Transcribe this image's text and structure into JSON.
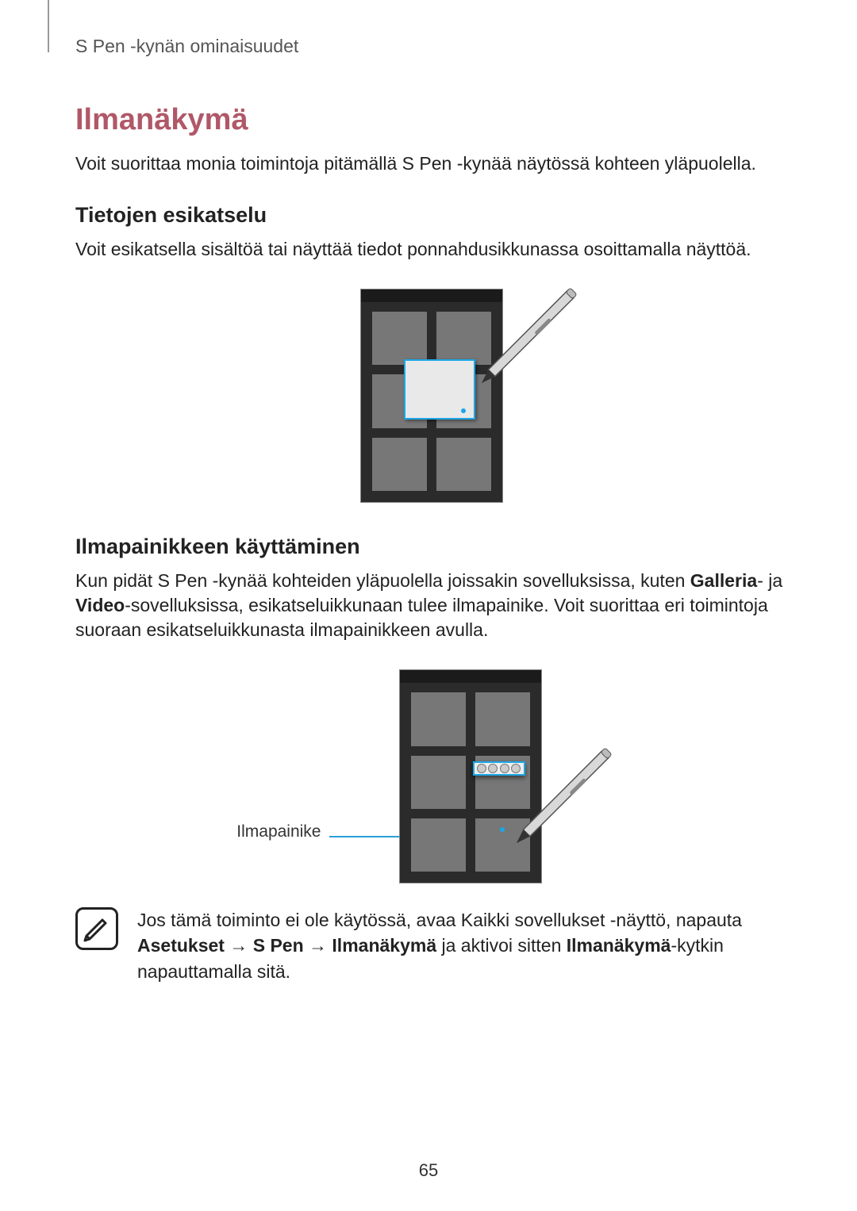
{
  "header": {
    "section": "S Pen -kynän ominaisuudet"
  },
  "title": "Ilmanäkymä",
  "intro": "Voit suorittaa monia toimintoja pitämällä S Pen -kynää näytössä kohteen yläpuolella.",
  "section1": {
    "heading": "Tietojen esikatselu",
    "body": "Voit esikatsella sisältöä tai näyttää tiedot ponnahdusikkunassa osoittamalla näyttöä."
  },
  "section2": {
    "heading": "Ilmapainikkeen käyttäminen",
    "body_pre": "Kun pidät S Pen -kynää kohteiden yläpuolella joissakin sovelluksissa, kuten ",
    "bold1": "Galleria",
    "body_mid1": "- ja ",
    "bold2": "Video",
    "body_post": "-sovelluksissa, esikatseluikkunaan tulee ilmapainike. Voit suorittaa eri toimintoja suoraan esikatseluikkunasta ilmapainikkeen avulla.",
    "figure_label": "Ilmapainike"
  },
  "note": {
    "pre": "Jos tämä toiminto ei ole käytössä, avaa Kaikki sovellukset -näyttö, napauta ",
    "b1": "Asetukset",
    "arrow": " → ",
    "b2": "S Pen",
    "b3": "Ilmanäkymä",
    "mid": " ja aktivoi sitten ",
    "b4": "Ilmanäkymä",
    "post": "-kytkin napauttamalla sitä."
  },
  "page_number": "65"
}
